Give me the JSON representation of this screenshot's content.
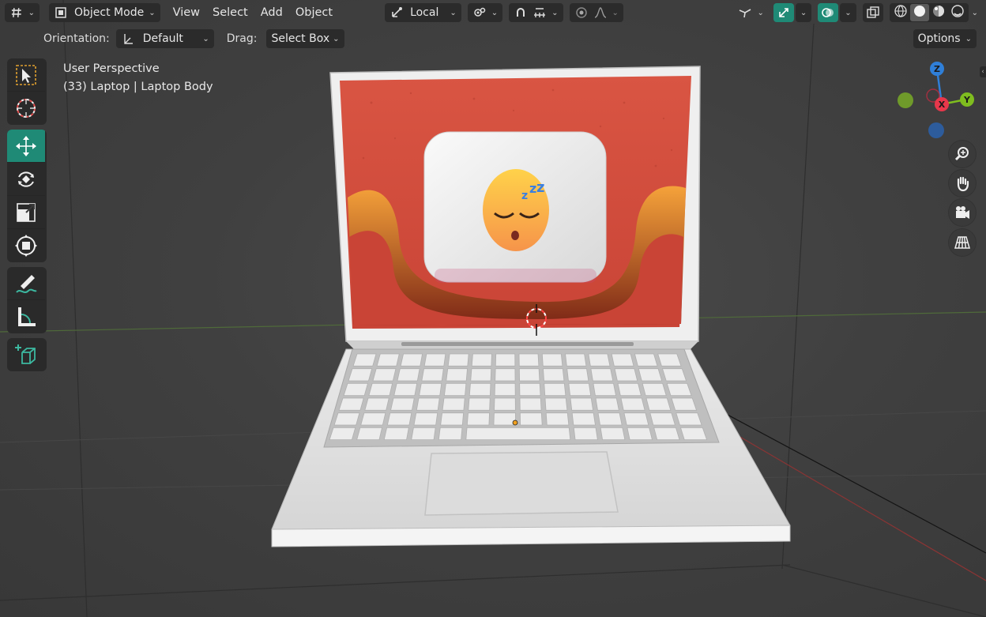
{
  "header": {
    "editor_type_icon": "viewport-editor-icon",
    "mode": "Object Mode",
    "menus": [
      "View",
      "Select",
      "Add",
      "Object"
    ],
    "transform_orientation": "Local",
    "pivot_icon": "pivot-icon",
    "snap_icon": "snap-icon",
    "proportional_icon": "proportional-icon",
    "falloff_icon": "falloff-icon",
    "visibility_icon": "visibility-icon",
    "gizmo_icon": "gizmo-icon",
    "overlay_icon": "overlay-icon",
    "xray_icon": "xray-icon",
    "shading_modes": [
      "wireframe",
      "solid",
      "material-preview",
      "rendered"
    ],
    "active_shading": "solid"
  },
  "tool_settings": {
    "orientation_label": "Orientation:",
    "orientation_value": "Default",
    "drag_label": "Drag:",
    "drag_value": "Select Box",
    "options_label": "Options"
  },
  "toolbar": {
    "tools": [
      "select-box",
      "cursor",
      "move",
      "rotate",
      "scale",
      "transform",
      "annotate",
      "measure",
      "add-cube"
    ],
    "active_tool": "move"
  },
  "viewport": {
    "view_name": "User Perspective",
    "object_info": "(33) Laptop | Laptop Body"
  },
  "navigation": {
    "axes": {
      "x": "X",
      "y": "Y",
      "z": "Z"
    },
    "buttons": [
      "zoom-icon",
      "hand-pan-icon",
      "camera-icon",
      "grid-perspective-icon"
    ]
  },
  "colors": {
    "accent": "#1f8a76",
    "axis_x": "#e8374b",
    "axis_y": "#7fbd1f",
    "axis_z": "#2f7fd8",
    "screen_bg": "#d8523f"
  }
}
